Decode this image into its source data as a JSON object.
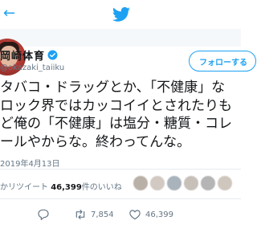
{
  "header": {
    "back_icon": "arrow-left-icon",
    "logo_icon": "twitter-bird-icon",
    "brand_color": "#1da1f2"
  },
  "author": {
    "name": "岡崎体育",
    "handle": "@okazaki_taiiku",
    "verified": true,
    "follow_label": "フォローする"
  },
  "tweet": {
    "lines": [
      "タバコ・ドラッグとか、「不健康」な",
      "ロック界ではカッコイイとされたりも",
      "ど俺の「不健康」は塩分・糖質・コレ",
      "ールやからな。終わってんな。"
    ],
    "date": "2019年4月13日"
  },
  "stats": {
    "retweets_suffix": "かリツイート",
    "likes_count": "46,399",
    "likes_suffix": "件のいいね"
  },
  "actions": {
    "reply_count": "",
    "retweet_count": "7,854",
    "like_count": "46,399"
  }
}
